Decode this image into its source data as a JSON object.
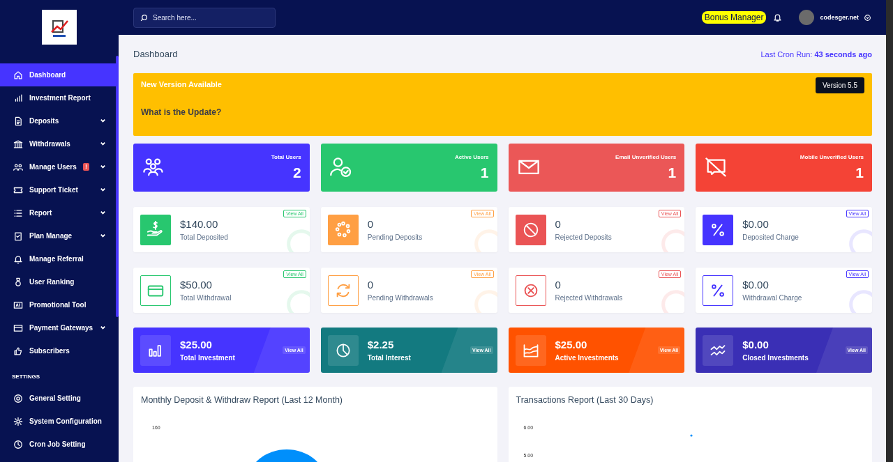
{
  "sidebar": {
    "items": [
      {
        "label": "Dashboard",
        "selected": true,
        "expandable": false
      },
      {
        "label": "Investment Report",
        "selected": false,
        "expandable": false
      },
      {
        "label": "Deposits",
        "selected": false,
        "expandable": true
      },
      {
        "label": "Withdrawals",
        "selected": false,
        "expandable": true
      },
      {
        "label": "Manage Users",
        "selected": false,
        "expandable": true,
        "badge": "!"
      },
      {
        "label": "Support Ticket",
        "selected": false,
        "expandable": true
      },
      {
        "label": "Report",
        "selected": false,
        "expandable": true
      },
      {
        "label": "Plan Manage",
        "selected": false,
        "expandable": true
      },
      {
        "label": "Manage Referral",
        "selected": false,
        "expandable": false
      },
      {
        "label": "User Ranking",
        "selected": false,
        "expandable": false
      },
      {
        "label": "Promotional Tool",
        "selected": false,
        "expandable": false
      },
      {
        "label": "Payment Gateways",
        "selected": false,
        "expandable": true
      },
      {
        "label": "Subscribers",
        "selected": false,
        "expandable": false
      }
    ],
    "settings_title": "SETTINGS",
    "settings_items": [
      {
        "label": "General Setting",
        "selected": false,
        "expandable": false
      },
      {
        "label": "System Configuration",
        "selected": false,
        "expandable": false
      },
      {
        "label": "Cron Job Setting",
        "selected": false,
        "expandable": false
      }
    ]
  },
  "topbar": {
    "search": {
      "placeholder": "Search here..."
    },
    "bonus_manager": "Bonus Manager",
    "username": "codesger.net"
  },
  "header": {
    "title": "Dashboard",
    "cron_label": "Last Cron Run:",
    "cron_value": "43 seconds ago"
  },
  "banner": {
    "title": "New Version Available",
    "version": "Version 5.5",
    "question": "What is the Update?"
  },
  "user_stats": [
    {
      "label": "Total Users",
      "value": "2",
      "color": "#4634ff"
    },
    {
      "label": "Active Users",
      "value": "1",
      "color": "#28c76f"
    },
    {
      "label": "Email Unverified Users",
      "value": "1",
      "color": "#eb5757"
    },
    {
      "label": "Mobile Unverified Users",
      "value": "1",
      "color": "#f44336"
    }
  ],
  "widgets": [
    {
      "value": "$140.00",
      "label": "Total Deposited",
      "link": "View All",
      "color": "#28c76f",
      "kind": "solid"
    },
    {
      "value": "0",
      "label": "Pending Deposits",
      "link": "View All",
      "color": "#ff9f43",
      "kind": "solid"
    },
    {
      "value": "0",
      "label": "Rejected Deposits",
      "link": "View All",
      "color": "#ea5455",
      "kind": "solid"
    },
    {
      "value": "$0.00",
      "label": "Deposited Charge",
      "link": "View All",
      "color": "#4634ff",
      "kind": "solid"
    },
    {
      "value": "$50.00",
      "label": "Total Withdrawal",
      "link": "View All",
      "color": "#28c76f",
      "kind": "outline"
    },
    {
      "value": "0",
      "label": "Pending Withdrawals",
      "link": "View All",
      "color": "#ff9f43",
      "kind": "outline"
    },
    {
      "value": "0",
      "label": "Rejected Withdrawals",
      "link": "View All",
      "color": "#ea5455",
      "kind": "outline"
    },
    {
      "value": "$0.00",
      "label": "Withdrawal Charge",
      "link": "View All",
      "color": "#4634ff",
      "kind": "outline"
    }
  ],
  "investments": [
    {
      "value": "$25.00",
      "label": "Total Investment",
      "link": "View All",
      "color": "#4634ff"
    },
    {
      "value": "$2.25",
      "label": "Total Interest",
      "link": "View All",
      "color": "#137a80"
    },
    {
      "value": "$25.00",
      "label": "Active Investments",
      "link": "View All",
      "color": "#ff5200"
    },
    {
      "value": "$0.00",
      "label": "Closed Investments",
      "link": "View All",
      "color": "#3a2fb5"
    }
  ],
  "charts": [
    {
      "title": "Monthly Deposit & Withdraw Report (Last 12 Month)",
      "axis_labels": [
        "160"
      ]
    },
    {
      "title": "Transactions Report (Last 30 Days)",
      "axis_labels": [
        "6.00",
        "5.00"
      ]
    }
  ]
}
